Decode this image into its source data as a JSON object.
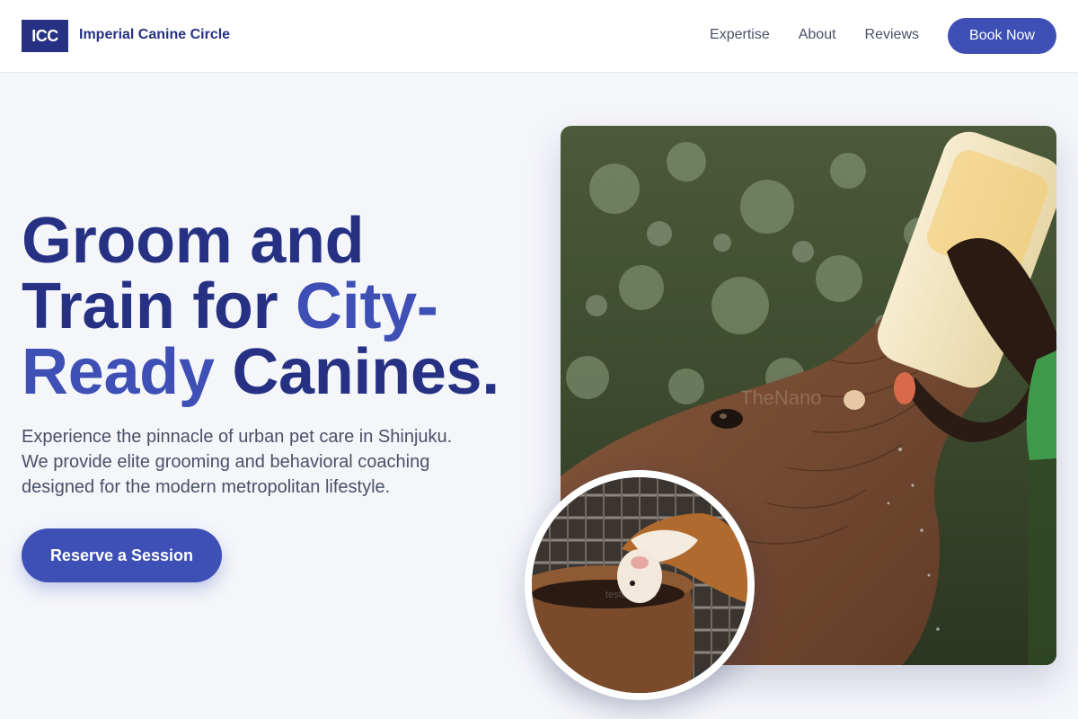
{
  "nav": {
    "logo_mark": "ICC",
    "brand": "Imperial Canine Circle",
    "links": [
      {
        "label": "Expertise"
      },
      {
        "label": "About"
      },
      {
        "label": "Reviews"
      }
    ],
    "cta": "Book Now"
  },
  "hero": {
    "headline_part1": "Groom and Train for ",
    "headline_accent1": "City-",
    "headline_accent2": "Ready",
    "headline_part2": " Canines.",
    "subtitle": "Experience the pinnacle of urban pet care in Shinjuku. We provide elite grooming and behavioral coaching designed for the modern metropolitan lifestyle.",
    "cta": "Reserve a Session"
  },
  "images": {
    "main_watermark": "TheNano",
    "thumb_watermark": "tester tokyo"
  },
  "colors": {
    "brand_dark": "#263184",
    "accent": "#3e4fb5",
    "text_muted": "#4a5068",
    "background": "#f5f6fa"
  }
}
